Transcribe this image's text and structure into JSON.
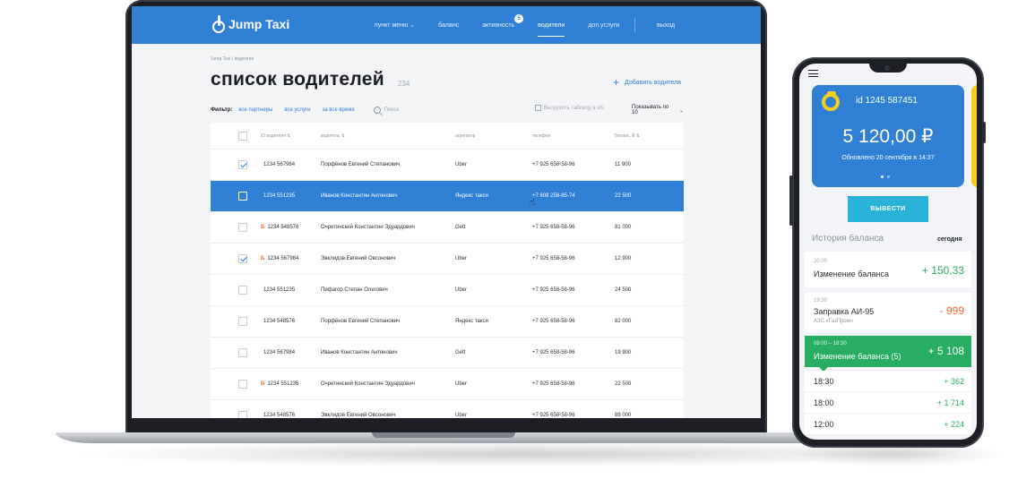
{
  "laptop": {
    "brand": "Jump Taxi",
    "nav": [
      {
        "label": "пункт меню ⌄"
      },
      {
        "label": "баланс"
      },
      {
        "label": "активность",
        "badge": "5"
      },
      {
        "label": "водители",
        "active": true
      },
      {
        "label": "доп.услуги"
      },
      {
        "label": "выход"
      }
    ],
    "breadcrumb": "Jump Taxi  /  водители",
    "title": "список водителей",
    "title_count": "234",
    "add_driver": "Добавить водителя",
    "filters": {
      "label": "Фильтр:",
      "partners": "все партнеры",
      "services": "все услуги",
      "period": "за все время",
      "search_placeholder": "Поиск",
      "export": "Выгрузить таблицу в xls",
      "per_page": "Показывать по 10"
    },
    "table": {
      "headers": {
        "id": "ID водителя ⇅",
        "name": "водитель ⇅",
        "aggregator": "агрегатор",
        "phone": "телефон",
        "balance": "баланс, ₽ ⇅"
      },
      "rows": [
        {
          "flag": "",
          "id": "1234 567984",
          "name": "Порфёнов Евгений Степанович",
          "agg": "Uber",
          "phone": "+7 925 658-58-96",
          "bal": "11 900",
          "checked": true
        },
        {
          "flag": "",
          "id": "1234 551235",
          "name": "Иванов Константин Антонович",
          "agg": "Яндекс такси",
          "phone": "+7 608 258-85-74",
          "bal": "22 500",
          "checked": false,
          "selected": true
        },
        {
          "flag": "Б",
          "id": "1234 548576",
          "name": "Очретинский Константин  Эдуардович",
          "agg": "Gett",
          "phone": "+7 925 658-58-96",
          "bal": "81 000",
          "checked": false
        },
        {
          "flag": "Б",
          "id": "1234 567984",
          "name": "Эвклидов Евгений Овсонович",
          "agg": "Uber",
          "phone": "+7 925 658-58-96",
          "bal": "12 900",
          "checked": true
        },
        {
          "flag": "",
          "id": "1234 551235",
          "name": "Пифагор Степан Олегович",
          "agg": "Uber",
          "phone": "+7 925 658-58-96",
          "bal": "24 500",
          "checked": false
        },
        {
          "flag": "",
          "id": "1234 548576",
          "name": "Порфёнов Евгений Степанович",
          "agg": "Яндекс такси",
          "phone": "+7 925 658-58-96",
          "bal": "82 000",
          "checked": false
        },
        {
          "flag": "",
          "id": "1234 567984",
          "name": "Иванов Константин Антонович",
          "agg": "Gett",
          "phone": "+7 925 658-58-96",
          "bal": "19 900",
          "checked": false
        },
        {
          "flag": "Б",
          "id": "1234 551235",
          "name": "Очретинский Константин  Эдуардович",
          "agg": "Uber",
          "phone": "+7 925 658-58-96",
          "bal": "22 500",
          "checked": false
        },
        {
          "flag": "",
          "id": "1234 548576",
          "name": "Эвклидов Евгений Овсонович",
          "agg": "Uber",
          "phone": "+7 925 658-58-96",
          "bal": "88 000",
          "checked": false
        }
      ]
    }
  },
  "phone": {
    "card_id": "id 1245 587451",
    "balance": "5 120,00 ₽",
    "updated": "Обновлено 20 сентября в 14:37",
    "withdraw": "ВЫВЕСТИ",
    "history_title": "История баланса",
    "history_today": "сегодня",
    "items": [
      {
        "time": "20:00",
        "label": "Изменение баланса",
        "sub": "",
        "amount": "+ 150,33",
        "kind": "pos"
      },
      {
        "time": "19:30",
        "label": "Заправка АИ-95",
        "sub": "АЗС «ГазПром»",
        "amount": "- 999",
        "kind": "neg"
      }
    ],
    "group": {
      "time": "08:00 – 18:30",
      "label": "Изменение баланса (5)",
      "amount": "+ 5 108"
    },
    "sub_items": [
      {
        "time": "18:30",
        "amount": "+ 362"
      },
      {
        "time": "18:00",
        "amount": "+ 1 714"
      },
      {
        "time": "12:00",
        "amount": "+ 224"
      }
    ]
  },
  "colors": {
    "brand": "#2f7fd4",
    "accent_yellow": "#f6cd1c",
    "positive": "#27ae60",
    "negative": "#ef6c33",
    "button": "#29b3d9"
  }
}
